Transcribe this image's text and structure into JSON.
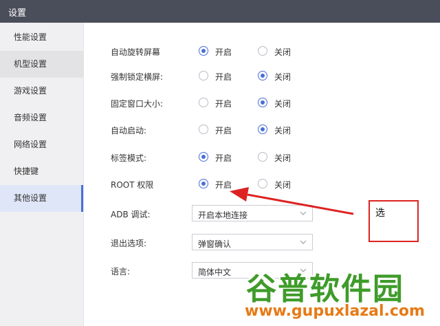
{
  "window": {
    "title": "设置"
  },
  "sidebar": {
    "items": [
      {
        "label": "性能设置"
      },
      {
        "label": "机型设置"
      },
      {
        "label": "游戏设置"
      },
      {
        "label": "音频设置"
      },
      {
        "label": "网络设置"
      },
      {
        "label": "快捷键"
      },
      {
        "label": "其他设置"
      }
    ],
    "active_index": 6
  },
  "settings": {
    "on_label": "开启",
    "off_label": "关闭",
    "radio_rows": [
      {
        "label": "自动旋转屏幕",
        "selected": "on"
      },
      {
        "label": "强制锁定横屏:",
        "selected": "off"
      },
      {
        "label": "固定窗口大小:",
        "selected": "off"
      },
      {
        "label": "自动启动:",
        "selected": "off"
      },
      {
        "label": "标签模式:",
        "selected": "on"
      },
      {
        "label": "ROOT 权限",
        "selected": "on"
      }
    ],
    "select_rows": [
      {
        "label": "ADB 调试:",
        "value": "开启本地连接"
      },
      {
        "label": "退出选项:",
        "value": "弹窗确认"
      },
      {
        "label": "语言:",
        "value": "简体中文"
      }
    ]
  },
  "annotation": {
    "text": "选",
    "color": "#dd2222"
  },
  "watermark": {
    "cn": "谷普软件园",
    "url": "www.gupuxlazal.com"
  },
  "colors": {
    "accent": "#4a6fd8",
    "titlebar": "#4a4e5a",
    "watermark_green": "#3f9b2a",
    "watermark_orange": "#e67a16"
  }
}
